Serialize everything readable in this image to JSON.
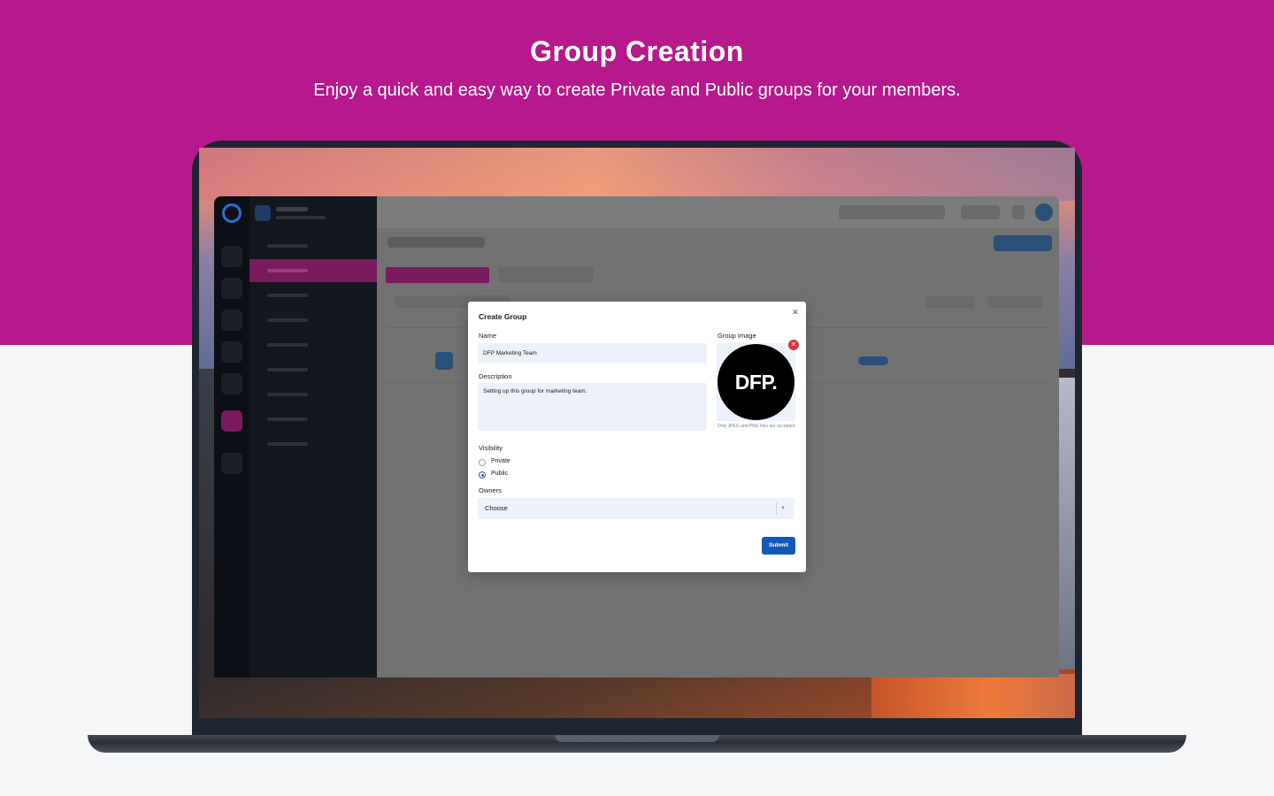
{
  "hero": {
    "title": "Group Creation",
    "subtitle": "Enjoy a quick and easy way to create Private and Public groups for your members."
  },
  "colors": {
    "hero_bg": "#b5198b",
    "accent_pink": "#7a1a5f",
    "primary_blue": "#1159b8",
    "remove_red": "#e0323c"
  },
  "modal": {
    "title": "Create Group",
    "close_icon": "close-icon",
    "name_label": "Name",
    "name_value": "DFP Marketing Team",
    "description_label": "Description",
    "description_value": "Setting up this group for marketing team.",
    "group_image_label": "Group Image",
    "group_image_text": "DFP.",
    "image_hint": "Only JPEG and PNG files are accepted",
    "visibility_label": "Visibility",
    "visibility_options": [
      "Private",
      "Public"
    ],
    "visibility_selected": "Public",
    "owners_label": "Owners",
    "owners_placeholder": "Choose",
    "submit_label": "Submit"
  }
}
